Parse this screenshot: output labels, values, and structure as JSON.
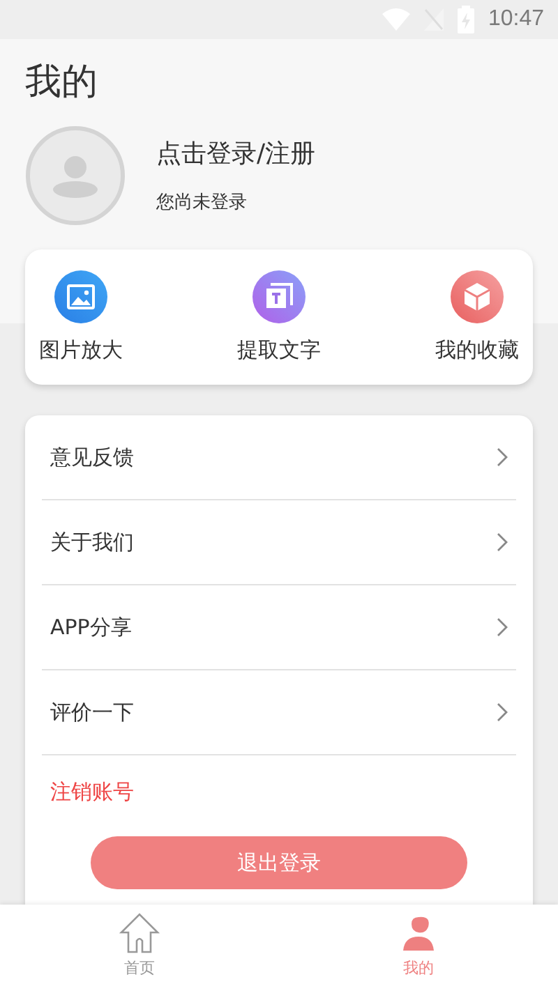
{
  "status_bar": {
    "time": "10:47"
  },
  "title": "我的",
  "profile": {
    "name": "点击登录/注册",
    "subtitle": "您尚未登录"
  },
  "shortcuts": [
    {
      "kind": "image",
      "label": "图片放大"
    },
    {
      "kind": "text",
      "label": "提取文字"
    },
    {
      "kind": "box",
      "label": "我的收藏"
    }
  ],
  "menu": [
    {
      "kind": "link",
      "label": "意见反馈"
    },
    {
      "kind": "link",
      "label": "关于我们"
    },
    {
      "kind": "link",
      "label": "APP分享"
    },
    {
      "kind": "link",
      "label": "评价一下"
    },
    {
      "kind": "danger",
      "label": "注销账号"
    }
  ],
  "logout_button": "退出登录",
  "nav": [
    {
      "kind": "home",
      "label": "首页",
      "selected": false
    },
    {
      "kind": "user",
      "label": "我的",
      "selected": true
    }
  ]
}
